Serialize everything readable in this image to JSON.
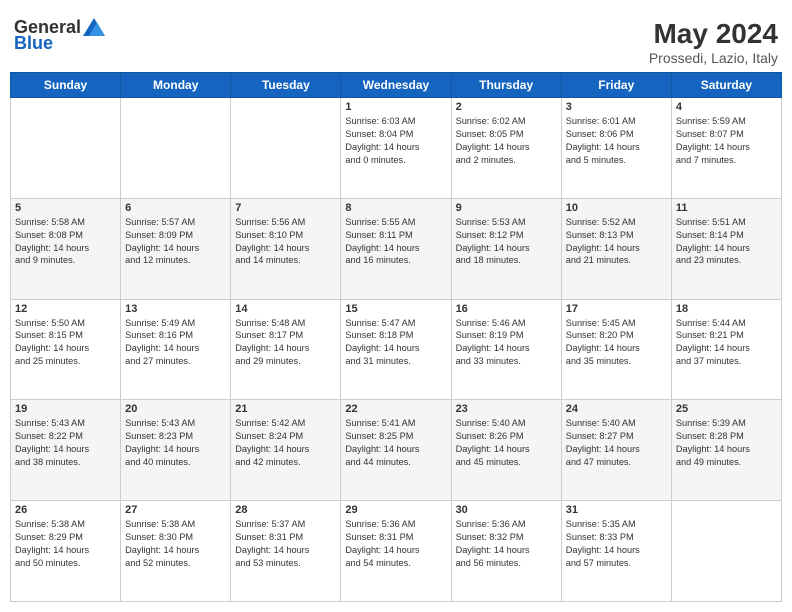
{
  "logo": {
    "general": "General",
    "blue": "Blue"
  },
  "header": {
    "title": "May 2024",
    "subtitle": "Prossedi, Lazio, Italy"
  },
  "weekdays": [
    "Sunday",
    "Monday",
    "Tuesday",
    "Wednesday",
    "Thursday",
    "Friday",
    "Saturday"
  ],
  "weeks": [
    [
      {
        "day": "",
        "content": ""
      },
      {
        "day": "",
        "content": ""
      },
      {
        "day": "",
        "content": ""
      },
      {
        "day": "1",
        "content": "Sunrise: 6:03 AM\nSunset: 8:04 PM\nDaylight: 14 hours\nand 0 minutes."
      },
      {
        "day": "2",
        "content": "Sunrise: 6:02 AM\nSunset: 8:05 PM\nDaylight: 14 hours\nand 2 minutes."
      },
      {
        "day": "3",
        "content": "Sunrise: 6:01 AM\nSunset: 8:06 PM\nDaylight: 14 hours\nand 5 minutes."
      },
      {
        "day": "4",
        "content": "Sunrise: 5:59 AM\nSunset: 8:07 PM\nDaylight: 14 hours\nand 7 minutes."
      }
    ],
    [
      {
        "day": "5",
        "content": "Sunrise: 5:58 AM\nSunset: 8:08 PM\nDaylight: 14 hours\nand 9 minutes."
      },
      {
        "day": "6",
        "content": "Sunrise: 5:57 AM\nSunset: 8:09 PM\nDaylight: 14 hours\nand 12 minutes."
      },
      {
        "day": "7",
        "content": "Sunrise: 5:56 AM\nSunset: 8:10 PM\nDaylight: 14 hours\nand 14 minutes."
      },
      {
        "day": "8",
        "content": "Sunrise: 5:55 AM\nSunset: 8:11 PM\nDaylight: 14 hours\nand 16 minutes."
      },
      {
        "day": "9",
        "content": "Sunrise: 5:53 AM\nSunset: 8:12 PM\nDaylight: 14 hours\nand 18 minutes."
      },
      {
        "day": "10",
        "content": "Sunrise: 5:52 AM\nSunset: 8:13 PM\nDaylight: 14 hours\nand 21 minutes."
      },
      {
        "day": "11",
        "content": "Sunrise: 5:51 AM\nSunset: 8:14 PM\nDaylight: 14 hours\nand 23 minutes."
      }
    ],
    [
      {
        "day": "12",
        "content": "Sunrise: 5:50 AM\nSunset: 8:15 PM\nDaylight: 14 hours\nand 25 minutes."
      },
      {
        "day": "13",
        "content": "Sunrise: 5:49 AM\nSunset: 8:16 PM\nDaylight: 14 hours\nand 27 minutes."
      },
      {
        "day": "14",
        "content": "Sunrise: 5:48 AM\nSunset: 8:17 PM\nDaylight: 14 hours\nand 29 minutes."
      },
      {
        "day": "15",
        "content": "Sunrise: 5:47 AM\nSunset: 8:18 PM\nDaylight: 14 hours\nand 31 minutes."
      },
      {
        "day": "16",
        "content": "Sunrise: 5:46 AM\nSunset: 8:19 PM\nDaylight: 14 hours\nand 33 minutes."
      },
      {
        "day": "17",
        "content": "Sunrise: 5:45 AM\nSunset: 8:20 PM\nDaylight: 14 hours\nand 35 minutes."
      },
      {
        "day": "18",
        "content": "Sunrise: 5:44 AM\nSunset: 8:21 PM\nDaylight: 14 hours\nand 37 minutes."
      }
    ],
    [
      {
        "day": "19",
        "content": "Sunrise: 5:43 AM\nSunset: 8:22 PM\nDaylight: 14 hours\nand 38 minutes."
      },
      {
        "day": "20",
        "content": "Sunrise: 5:43 AM\nSunset: 8:23 PM\nDaylight: 14 hours\nand 40 minutes."
      },
      {
        "day": "21",
        "content": "Sunrise: 5:42 AM\nSunset: 8:24 PM\nDaylight: 14 hours\nand 42 minutes."
      },
      {
        "day": "22",
        "content": "Sunrise: 5:41 AM\nSunset: 8:25 PM\nDaylight: 14 hours\nand 44 minutes."
      },
      {
        "day": "23",
        "content": "Sunrise: 5:40 AM\nSunset: 8:26 PM\nDaylight: 14 hours\nand 45 minutes."
      },
      {
        "day": "24",
        "content": "Sunrise: 5:40 AM\nSunset: 8:27 PM\nDaylight: 14 hours\nand 47 minutes."
      },
      {
        "day": "25",
        "content": "Sunrise: 5:39 AM\nSunset: 8:28 PM\nDaylight: 14 hours\nand 49 minutes."
      }
    ],
    [
      {
        "day": "26",
        "content": "Sunrise: 5:38 AM\nSunset: 8:29 PM\nDaylight: 14 hours\nand 50 minutes."
      },
      {
        "day": "27",
        "content": "Sunrise: 5:38 AM\nSunset: 8:30 PM\nDaylight: 14 hours\nand 52 minutes."
      },
      {
        "day": "28",
        "content": "Sunrise: 5:37 AM\nSunset: 8:31 PM\nDaylight: 14 hours\nand 53 minutes."
      },
      {
        "day": "29",
        "content": "Sunrise: 5:36 AM\nSunset: 8:31 PM\nDaylight: 14 hours\nand 54 minutes."
      },
      {
        "day": "30",
        "content": "Sunrise: 5:36 AM\nSunset: 8:32 PM\nDaylight: 14 hours\nand 56 minutes."
      },
      {
        "day": "31",
        "content": "Sunrise: 5:35 AM\nSunset: 8:33 PM\nDaylight: 14 hours\nand 57 minutes."
      },
      {
        "day": "",
        "content": ""
      }
    ]
  ]
}
